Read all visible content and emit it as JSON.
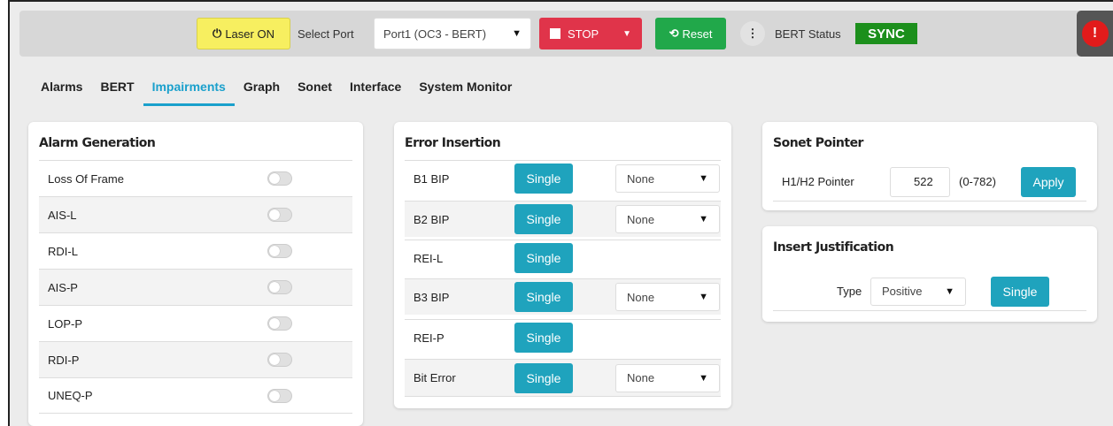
{
  "toolbar": {
    "laser_icon": "power-icon",
    "laser_label": "Laser ON",
    "laser_glyph": "⏻",
    "select_port_label": "Select Port",
    "port_value": "Port1 (OC3 - BERT)",
    "stop_label": "STOP",
    "reset_label": "Reset",
    "bert_status_label": "BERT Status",
    "bert_status_value": "SYNC"
  },
  "tabs": [
    {
      "label": "Alarms"
    },
    {
      "label": "BERT"
    },
    {
      "label": "Impairments"
    },
    {
      "label": "Graph"
    },
    {
      "label": "Sonet"
    },
    {
      "label": "Interface"
    },
    {
      "label": "System Monitor"
    }
  ],
  "active_tab": "Impairments",
  "alarm_generation": {
    "title": "Alarm Generation",
    "items": [
      {
        "label": "Loss Of Frame",
        "on": false
      },
      {
        "label": "AIS-L",
        "on": false
      },
      {
        "label": "RDI-L",
        "on": false
      },
      {
        "label": "AIS-P",
        "on": false
      },
      {
        "label": "LOP-P",
        "on": false
      },
      {
        "label": "RDI-P",
        "on": false
      },
      {
        "label": "UNEQ-P",
        "on": false
      }
    ]
  },
  "error_insertion": {
    "title": "Error Insertion",
    "button_label": "Single",
    "rows": [
      {
        "label": "B1 BIP",
        "select": "None"
      },
      {
        "label": "B2 BIP",
        "select": "None"
      },
      {
        "label": "REI-L",
        "select": null
      },
      {
        "label": "B3 BIP",
        "select": "None"
      },
      {
        "label": "REI-P",
        "select": null
      },
      {
        "label": "Bit Error",
        "select": "None"
      }
    ]
  },
  "sonet_pointer": {
    "title": "Sonet Pointer",
    "field_label": "H1/H2 Pointer",
    "value": "522",
    "range": "(0-782)",
    "apply_label": "Apply"
  },
  "insert_justification": {
    "title": "Insert Justification",
    "type_label": "Type",
    "type_value": "Positive",
    "button_label": "Single"
  },
  "colors": {
    "accent": "#1aa0cc",
    "single_button": "#1fa3bd",
    "stop": "#e0344a",
    "reset": "#21a84a",
    "sync": "#1c8f1c",
    "laser": "#f7ef60"
  }
}
